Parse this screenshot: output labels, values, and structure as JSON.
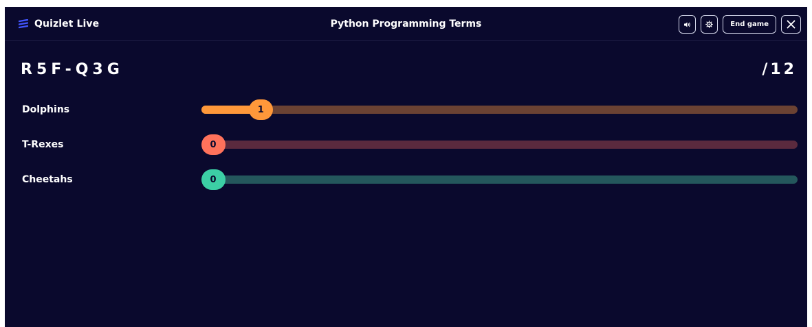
{
  "header": {
    "app_name": "Quizlet Live",
    "set_title": "Python Programming Terms",
    "sound_icon": "speaker-icon",
    "settings_icon": "gear-icon",
    "end_game_label": "End game",
    "close_icon": "close-icon"
  },
  "game": {
    "code": "R5F-Q3G",
    "total": "/12"
  },
  "teams": [
    {
      "name": "Dolphins",
      "score": "1",
      "progress": 0.0833,
      "color": "#ff983a",
      "track_color": "#6b4233"
    },
    {
      "name": "T-Rexes",
      "score": "0",
      "progress": 0,
      "color": "#ff725b",
      "track_color": "#5a2a3e"
    },
    {
      "name": "Cheetahs",
      "score": "0",
      "progress": 0,
      "color": "#3ccfa5",
      "track_color": "#24575c"
    }
  ]
}
